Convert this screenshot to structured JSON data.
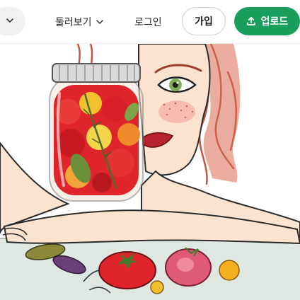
{
  "header": {
    "explore_label": "둘러보기",
    "login_label": "로그인",
    "join_label": "가입",
    "upload_label": "업로드"
  },
  "icons": {
    "menu_chevron": "chevron-down-icon",
    "explore_chevron": "chevron-down-icon",
    "upload": "upload-icon"
  },
  "colors": {
    "upload_button": "#1a9e5c",
    "skin": "#fbe3cf",
    "hair": "#c5563f",
    "tomato": "#e0242b",
    "table": "#dfe7e2"
  }
}
